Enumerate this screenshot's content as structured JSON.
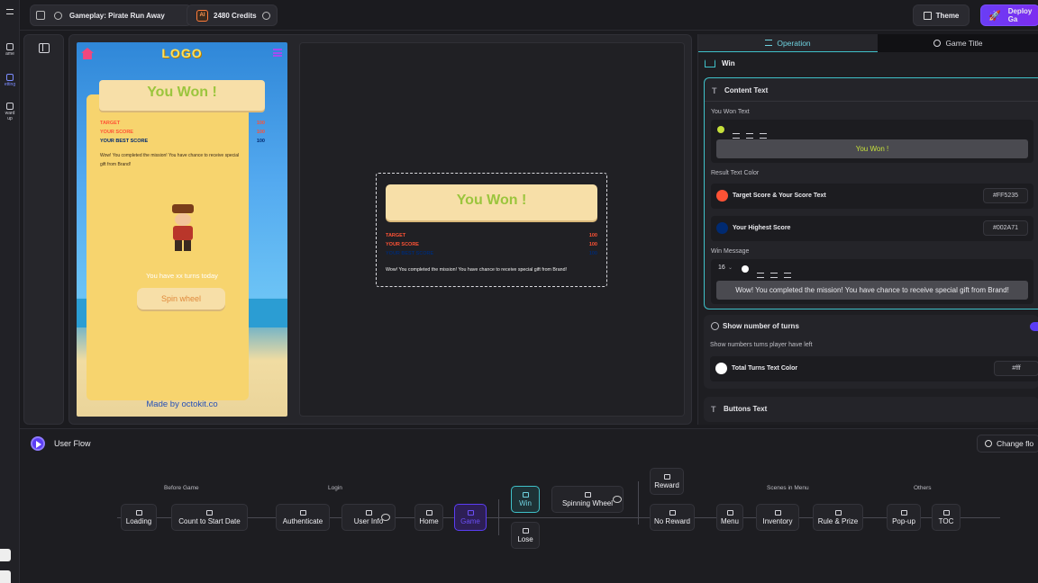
{
  "topbar": {
    "game_title": "Gameplay: Pirate Run Away",
    "credits": "2480 Credits",
    "credits_badge": "AI",
    "theme_label": "Theme",
    "deploy_label": "Deploy Ga"
  },
  "rail": {
    "items": [
      {
        "label": "ame"
      },
      {
        "label": "etting"
      },
      {
        "label": "ward"
      },
      {
        "label": "up"
      }
    ]
  },
  "preview": {
    "logo": "LOGO",
    "you_won": "You Won !",
    "target_label": "TARGET",
    "target_value": "100",
    "your_score_label": "YOUR SCORE",
    "your_score_value": "100",
    "best_score_label": "YOUR BEST SCORE",
    "best_score_value": "100",
    "message": "Wow! You completed the mission! You have chance to receive special gift from Brand!",
    "turns_text": "You have xx turns today",
    "spin_wheel": "Spin wheel",
    "made_by": "Made by octokit.co"
  },
  "canvas": {
    "you_won": "You Won !",
    "target_label": "TARGET",
    "target_value": "100",
    "your_score_label": "YOUR SCORE",
    "your_score_value": "100",
    "best_score_label": "YOUR BEST SCORE",
    "best_score_value": "100",
    "message": "Wow! You completed the mission! You have chance to receive special gift from Brand!"
  },
  "panel": {
    "tabs": [
      {
        "label": "Operation",
        "active": true
      },
      {
        "label": "Game Title",
        "active": false
      }
    ],
    "section_title": "Win",
    "content_text_title": "Content Text",
    "you_won_text_label": "You Won Text",
    "you_won_text_value": "You Won !",
    "result_text_color_label": "Result Text Color",
    "target_score_label": "Target Score & Your Score Text",
    "target_score_color": "#FF5235",
    "highest_score_label": "Your Highest Score",
    "highest_score_color": "#002A71",
    "win_message_label": "Win Message",
    "win_message_font_size": "16",
    "win_message_value": "Wow! You completed the mission! You have chance to receive special gift from Brand!",
    "show_turns_title": "Show number of turns",
    "show_turns_desc": "Show numbers turns player have left",
    "show_turns_enabled": true,
    "turns_color_label": "Total Turns Text Color",
    "turns_color_value": "#fff",
    "buttons_text_title": "Buttons Text"
  },
  "flow": {
    "title": "User Flow",
    "change_flow": "Change flo",
    "groups": {
      "before_game": "Before Game",
      "login": "Login",
      "scenes_in_menu": "Scenes in Menu",
      "others": "Others"
    },
    "nodes": {
      "loading": "Loading",
      "count_to_start": "Count to Start Date",
      "authenticate": "Authenticate",
      "user_info": "User Info",
      "home": "Home",
      "game": "Game",
      "win": "Win",
      "lose": "Lose",
      "spinning_wheel": "Spinning Wheel",
      "reward": "Reward",
      "no_reward": "No Reward",
      "menu": "Menu",
      "inventory": "Inventory",
      "rule_prize": "Rule & Prize",
      "popup": "Pop-up",
      "toc": "TOC"
    }
  },
  "colors": {
    "accent": "#5b3df5",
    "teal": "#3fc1c9",
    "win_text": "#9bc53d",
    "target_score": "#FF5235",
    "highest_score": "#002A71",
    "yellow_dot": "#c6e03b"
  }
}
